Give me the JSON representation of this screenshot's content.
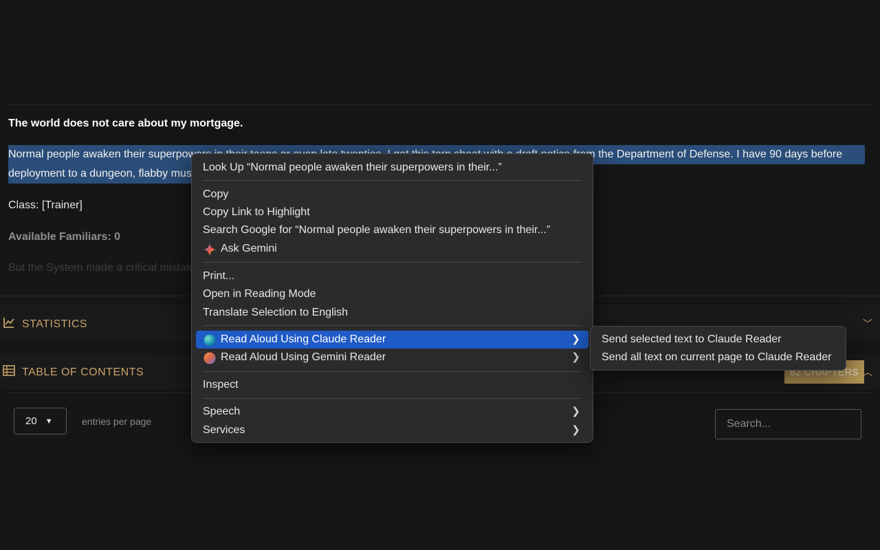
{
  "story": {
    "heading": "The world does not care about my mortgage.",
    "paragraph_line1": "Normal people awaken their superpowers in their teens or even late twenties. I got this torn sheet with a draft notice from the Department of Defense. I have 90 days before",
    "paragraph_line2": "deployment to a dungeon, flabby muscles and all.",
    "class_line": "Class: [Trainer]",
    "familiars_line": "Available Familiars: 0",
    "faded_line": "But the System made a critical mistake."
  },
  "sections": {
    "statistics_label": "STATISTICS",
    "toc_label": "TABLE OF CONTENTS",
    "chapters_badge": "82 CHAPTERS"
  },
  "table_controls": {
    "page_size_value": "20",
    "entries_label": "entries per page",
    "search_placeholder": "Search..."
  },
  "context_menu": {
    "look_up": "Look Up “Normal people awaken their superpowers in their...”",
    "copy": "Copy",
    "copy_link": "Copy Link to Highlight",
    "search_google": "Search Google for “Normal people awaken their superpowers in their...”",
    "ask_gemini": "Ask Gemini",
    "print": "Print...",
    "reading_mode": "Open in Reading Mode",
    "translate": "Translate Selection to English",
    "read_claude": "Read Aloud Using Claude Reader",
    "read_gemini": "Read Aloud Using Gemini Reader",
    "inspect": "Inspect",
    "speech": "Speech",
    "services": "Services"
  },
  "submenu": {
    "send_selected": "Send selected text to Claude Reader",
    "send_all": "Send all text on current page to Claude Reader"
  },
  "icons": {
    "statistics": "line-chart-icon",
    "toc": "table-icon",
    "gemini": "gemini-sparkle-icon",
    "claude_reader": "globe-teal-icon",
    "gemini_reader": "globe-orange-icon"
  },
  "colors": {
    "accent_gold": "#c9a46a",
    "selection_blue": "#2a4d79",
    "menu_active": "#1f5bc6"
  }
}
